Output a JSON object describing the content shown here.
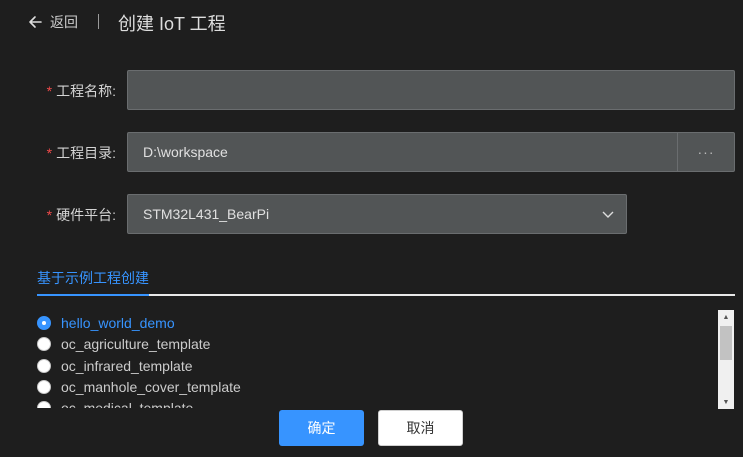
{
  "header": {
    "back_label": "返回",
    "title": "创建 IoT 工程"
  },
  "form": {
    "required_mark": "*",
    "project_name": {
      "label": "工程名称:",
      "value": ""
    },
    "project_dir": {
      "label": "工程目录:",
      "value": "D:\\workspace",
      "browse_label": "···"
    },
    "hardware_platform": {
      "label": "硬件平台:",
      "value": "STM32L431_BearPi"
    }
  },
  "tab": {
    "label": "基于示例工程创建"
  },
  "templates": [
    {
      "label": "hello_world_demo",
      "selected": true
    },
    {
      "label": "oc_agriculture_template",
      "selected": false
    },
    {
      "label": "oc_infrared_template",
      "selected": false
    },
    {
      "label": "oc_manhole_cover_template",
      "selected": false
    },
    {
      "label": "oc_medical_template",
      "selected": false
    }
  ],
  "buttons": {
    "confirm": "确定",
    "cancel": "取消"
  },
  "colors": {
    "accent": "#3794ff",
    "background": "#1e1e1e",
    "input_bg": "#525556",
    "required": "#f04a4a"
  }
}
